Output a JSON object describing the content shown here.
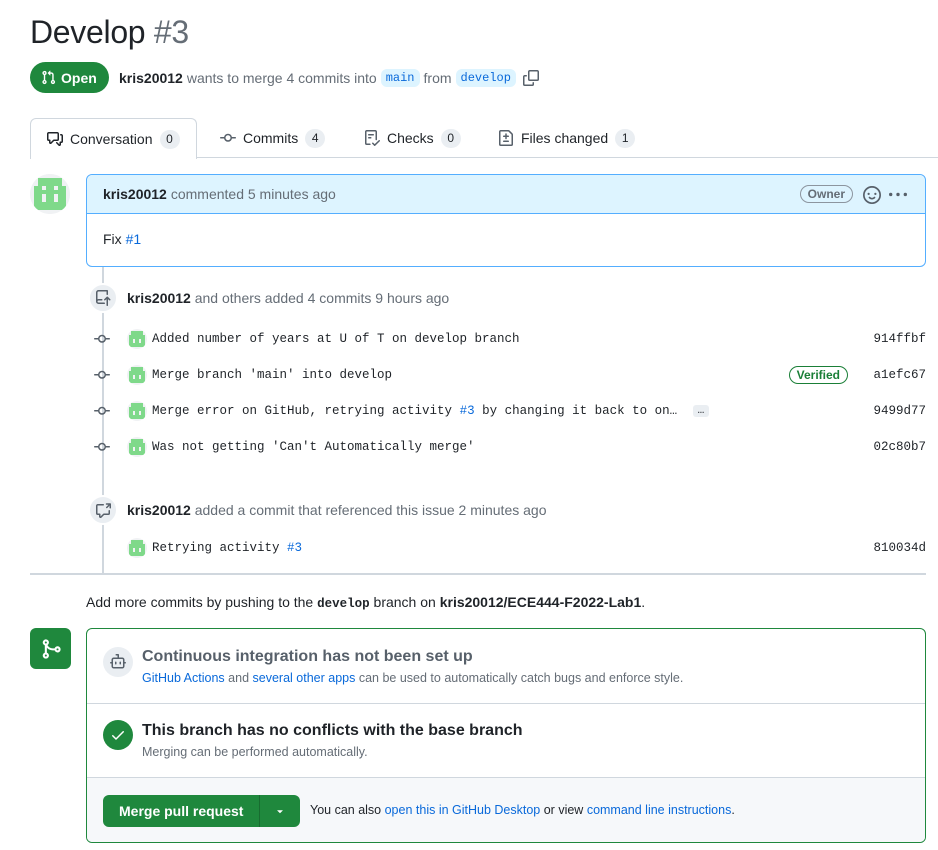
{
  "header": {
    "title": "Develop",
    "number": "#3",
    "state": "Open",
    "author": "kris20012",
    "merge_text": "wants to merge 4 commits into",
    "base_branch": "main",
    "from_text": "from",
    "head_branch": "develop"
  },
  "tabs": [
    {
      "label": "Conversation",
      "count": "0",
      "icon": "comment-discussion-icon"
    },
    {
      "label": "Commits",
      "count": "4",
      "icon": "git-commit-icon"
    },
    {
      "label": "Checks",
      "count": "0",
      "icon": "checklist-icon"
    },
    {
      "label": "Files changed",
      "count": "1",
      "icon": "file-diff-icon"
    }
  ],
  "comment": {
    "author": "kris20012",
    "action": "commented 5 minutes ago",
    "role": "Owner",
    "body_text": "Fix",
    "body_link": "#1"
  },
  "commits_event": {
    "author": "kris20012",
    "text": "and others added 4 commits 9 hours ago",
    "commits": [
      {
        "message": "Added number of years at U of T on develop branch",
        "sha": "914ffbf"
      },
      {
        "message": "Merge branch 'main' into develop",
        "sha": "a1efc67",
        "badge": "Verified"
      },
      {
        "message_prefix": "Merge error on GitHub, retrying activity",
        "message_link": "#3",
        "message_suffix": "by changing it back to on…",
        "sha": "9499d77",
        "ellipsis": "…"
      },
      {
        "message": "Was not getting 'Can't Automatically merge'",
        "sha": "02c80b7"
      }
    ]
  },
  "ref_event": {
    "author": "kris20012",
    "text": "added a commit that referenced this issue 2 minutes ago",
    "commit_prefix": "Retrying activity",
    "commit_link": "#3",
    "sha": "810034d"
  },
  "hint": {
    "prefix": "Add more commits by pushing to the",
    "branch": "develop",
    "middle": "branch on",
    "repo": "kris20012/ECE444-F2022-Lab1",
    "suffix": "."
  },
  "merge_box": {
    "ci_title": "Continuous integration has not been set up",
    "ci_link1": "GitHub Actions",
    "ci_and": "and",
    "ci_link2": "several other apps",
    "ci_rest": "can be used to automatically catch bugs and enforce style.",
    "ok_title": "This branch has no conflicts with the base branch",
    "ok_sub": "Merging can be performed automatically.",
    "merge_label": "Merge pull request",
    "note_prefix": "You can also",
    "note_link1": "open this in GitHub Desktop",
    "note_mid": "or view",
    "note_link2": "command line instructions",
    "note_suffix": "."
  },
  "colors": {
    "open_green": "#1f883d",
    "link_blue": "#0969da",
    "comment_border": "#54aeff",
    "comment_header_bg": "#ddf4ff"
  }
}
